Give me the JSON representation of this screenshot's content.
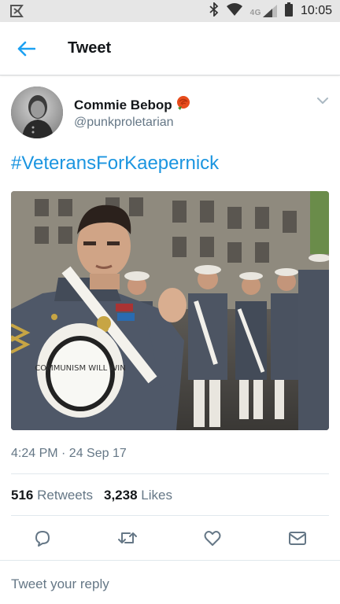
{
  "status_bar": {
    "time": "10:05",
    "network_label": "4G",
    "icons": [
      "notification-icon",
      "bluetooth-icon",
      "wifi-icon",
      "cellular-signal-icon",
      "battery-icon"
    ]
  },
  "app_bar": {
    "title": "Tweet",
    "back_icon": "back-arrow-icon"
  },
  "tweet": {
    "author_name": "Commie Bebop",
    "author_emoji": "rose-emoji",
    "handle": "@punkproletarian",
    "text": "#VeteransForKaepernick",
    "photo_caption_text": "COMMUNISM WILL WIN",
    "timestamp": "4:24 PM · 24 Sep 17",
    "retweets_count": "516",
    "retweets_label": "Retweets",
    "likes_count": "3,238",
    "likes_label": "Likes"
  },
  "actions": [
    "reply-icon",
    "retweet-icon",
    "like-icon",
    "direct-message-icon"
  ],
  "reply": {
    "placeholder": "Tweet your reply"
  },
  "colors": {
    "link_blue": "#1b95e0",
    "secondary_text": "#657786",
    "divider": "#e1e8ed"
  }
}
